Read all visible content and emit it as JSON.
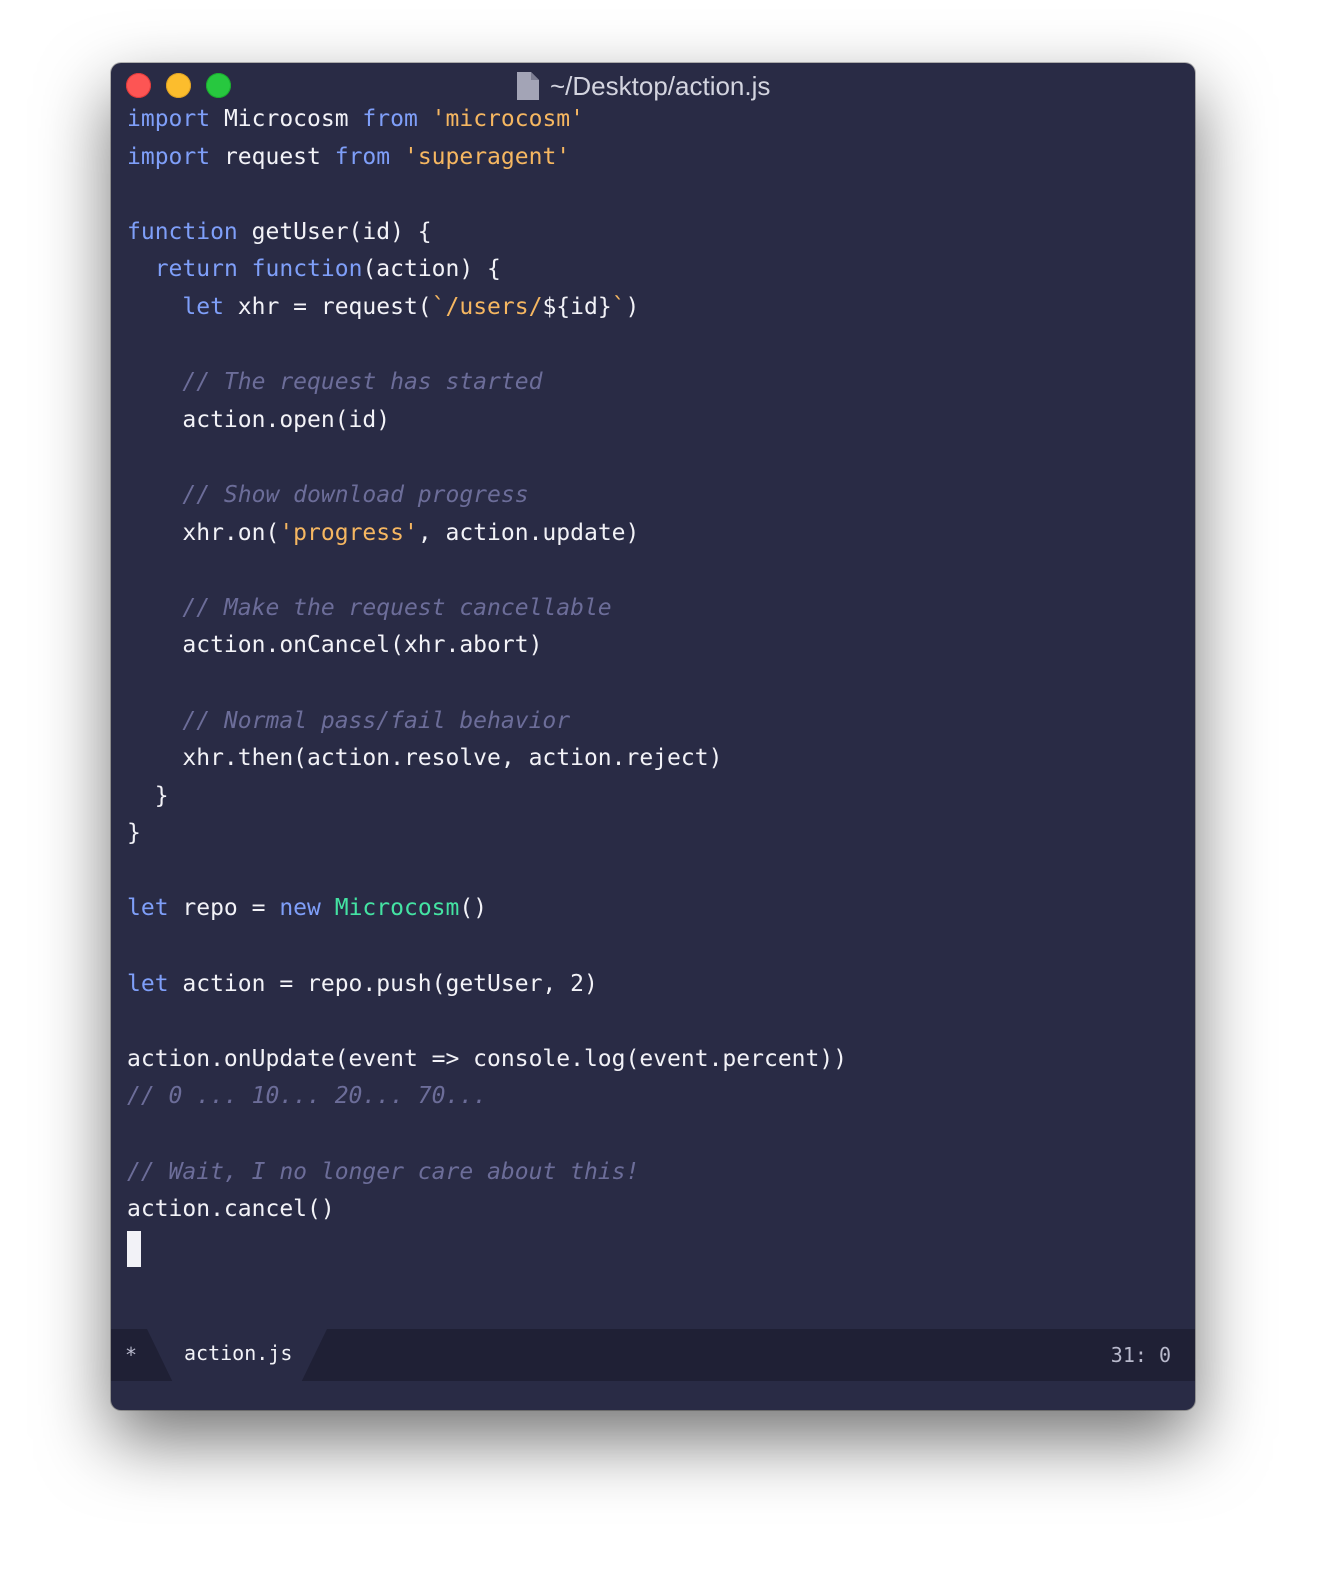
{
  "window": {
    "title": "~/Desktop/action.js"
  },
  "code": {
    "lines": [
      [
        {
          "t": "import",
          "c": "kw"
        },
        {
          "t": " Microcosm "
        },
        {
          "t": "from",
          "c": "kw"
        },
        {
          "t": " "
        },
        {
          "t": "'microcosm'",
          "c": "str"
        }
      ],
      [
        {
          "t": "import",
          "c": "kw"
        },
        {
          "t": " request "
        },
        {
          "t": "from",
          "c": "kw"
        },
        {
          "t": " "
        },
        {
          "t": "'superagent'",
          "c": "str"
        }
      ],
      [],
      [
        {
          "t": "function",
          "c": "kw"
        },
        {
          "t": " getUser(id) {"
        }
      ],
      [
        {
          "t": "  "
        },
        {
          "t": "return",
          "c": "kw"
        },
        {
          "t": " "
        },
        {
          "t": "function",
          "c": "kw"
        },
        {
          "t": "(action) {"
        }
      ],
      [
        {
          "t": "    "
        },
        {
          "t": "let",
          "c": "kw"
        },
        {
          "t": " xhr = request("
        },
        {
          "t": "`/users/",
          "c": "str"
        },
        {
          "t": "${id}"
        },
        {
          "t": "`",
          "c": "str"
        },
        {
          "t": ")"
        }
      ],
      [],
      [
        {
          "t": "    "
        },
        {
          "t": "// The request has started",
          "c": "cm"
        }
      ],
      [
        {
          "t": "    action.open(id)"
        }
      ],
      [],
      [
        {
          "t": "    "
        },
        {
          "t": "// Show download progress",
          "c": "cm"
        }
      ],
      [
        {
          "t": "    xhr.on("
        },
        {
          "t": "'progress'",
          "c": "str"
        },
        {
          "t": ", action.update)"
        }
      ],
      [],
      [
        {
          "t": "    "
        },
        {
          "t": "// Make the request cancellable",
          "c": "cm"
        }
      ],
      [
        {
          "t": "    action.onCancel(xhr.abort)"
        }
      ],
      [],
      [
        {
          "t": "    "
        },
        {
          "t": "// Normal pass/fail behavior",
          "c": "cm"
        }
      ],
      [
        {
          "t": "    xhr.then(action.resolve, action.reject)"
        }
      ],
      [
        {
          "t": "  }"
        }
      ],
      [
        {
          "t": "}"
        }
      ],
      [],
      [
        {
          "t": "let",
          "c": "kw"
        },
        {
          "t": " repo = "
        },
        {
          "t": "new",
          "c": "kw"
        },
        {
          "t": " "
        },
        {
          "t": "Microcosm",
          "c": "cls"
        },
        {
          "t": "()"
        }
      ],
      [],
      [
        {
          "t": "let",
          "c": "kw"
        },
        {
          "t": " action = repo.push(getUser, 2)"
        }
      ],
      [],
      [
        {
          "t": "action.onUpdate(event => console.log(event.percent))"
        }
      ],
      [
        {
          "t": "// 0 ... 10... 20... 70...",
          "c": "cm"
        }
      ],
      [],
      [
        {
          "t": "// Wait, I no longer care about this!",
          "c": "cm"
        }
      ],
      [
        {
          "t": "action.cancel()"
        }
      ]
    ]
  },
  "statusbar": {
    "modified_marker": "*",
    "tab_label": "action.js",
    "cursor_position": "31: 0"
  },
  "colors": {
    "background": "#292b45",
    "keyword": "#7f9ff9",
    "string": "#f6b761",
    "comment": "#6c6d99",
    "class": "#44e3a3",
    "text": "#f2f2f7"
  }
}
